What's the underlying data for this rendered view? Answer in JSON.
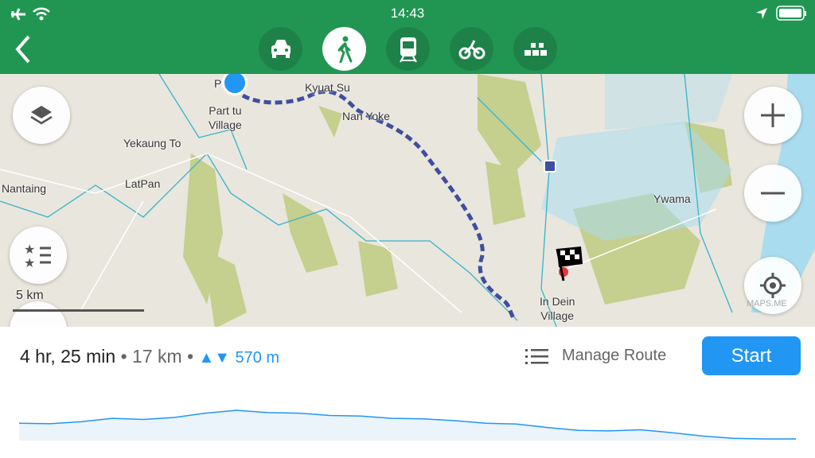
{
  "status_bar": {
    "time": "14:43",
    "icons": [
      "airplane-icon",
      "wifi-icon",
      "location-arrow-icon",
      "battery-icon"
    ]
  },
  "transport_modes": [
    {
      "name": "car",
      "icon": "car-icon",
      "active": false
    },
    {
      "name": "walk",
      "icon": "pedestrian-icon",
      "active": true
    },
    {
      "name": "transit",
      "icon": "train-icon",
      "active": false
    },
    {
      "name": "bike",
      "icon": "bicycle-icon",
      "active": false
    },
    {
      "name": "taxi",
      "icon": "taxi-icon",
      "active": false
    }
  ],
  "map": {
    "labels": {
      "start_partial": "P",
      "start": "Part tu\nVillage",
      "kyuat_su": "Kyuat Su",
      "nan_yoke": "Nan Yoke",
      "yekaung_to": "Yekaung To",
      "latpan": "LatPan",
      "nantaing": "Nantaing",
      "ywama": "Ywama",
      "destination": "In Dein\nVillage"
    },
    "scale": "5 km",
    "watermark": "MAPS.ME",
    "colors": {
      "route": "#3f4ea0",
      "water": "#a9dcee",
      "forest": "#c5cf8e",
      "land": "#e9e6dd",
      "my_position": "#2196f3"
    }
  },
  "route": {
    "duration": "4 hr, 25 min",
    "distance": "17 km",
    "elevation": "570 m",
    "elevation_icon": "up-down-arrows-icon",
    "manage_label": "Manage Route",
    "start_label": "Start",
    "separator": "•"
  },
  "elevation_profile": [
    0.55,
    0.53,
    0.6,
    0.72,
    0.68,
    0.75,
    0.9,
    1.0,
    0.92,
    0.9,
    0.82,
    0.8,
    0.72,
    0.7,
    0.64,
    0.55,
    0.52,
    0.4,
    0.3,
    0.28,
    0.32,
    0.22,
    0.1,
    0.02,
    0.0,
    0.0
  ]
}
